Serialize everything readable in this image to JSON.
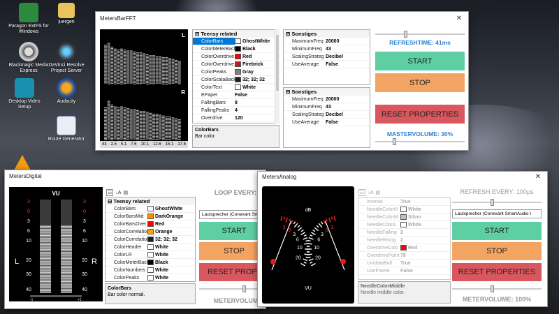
{
  "desktop": {
    "icons": [
      {
        "label": "Paragon ExtFS for Windows",
        "icon": "drive-icon"
      },
      {
        "label": "juergen",
        "icon": "folder-icon"
      },
      {
        "label": "Blackmagic Media Express",
        "icon": "film-reel-icon"
      },
      {
        "label": "DaVinci Resolve Project Server",
        "icon": "davinci-icon"
      },
      {
        "label": "Desktop Video Setup",
        "icon": "video-setup-icon"
      },
      {
        "label": "Audacity",
        "icon": "audacity-icon"
      },
      {
        "label": "Route Generator",
        "icon": "route-icon"
      }
    ]
  },
  "fft": {
    "title": "MetersBarFFT",
    "close": "✕",
    "channel_l": "L",
    "channel_r": "R",
    "freq_labels": [
      "43",
      "2.5",
      "5.1",
      "7.6",
      "10.1",
      "12.6",
      "15.1",
      "17.6"
    ],
    "bars_top": [
      0.82,
      0.86,
      0.78,
      0.74,
      0.72,
      0.74,
      0.72,
      0.7,
      0.7,
      0.68,
      0.66,
      0.66,
      0.64,
      0.62,
      0.6,
      0.6,
      0.58,
      0.58,
      0.56,
      0.56,
      0.54,
      0.52,
      0.5,
      0.48
    ],
    "bars_bottom": [
      0.7,
      0.84,
      0.76,
      0.72,
      0.7,
      0.72,
      0.7,
      0.68,
      0.66,
      0.66,
      0.64,
      0.62,
      0.62,
      0.6,
      0.58,
      0.56,
      0.56,
      0.54,
      0.52,
      0.5,
      0.5,
      0.48,
      0.46,
      0.44
    ],
    "props": {
      "category": "Teensy related",
      "rows": [
        {
          "k": "ColorBars",
          "v": "GhostWhite",
          "c": "#f8f8ff",
          "sel": true
        },
        {
          "k": "ColorMeterBack",
          "v": "Black",
          "c": "#000000"
        },
        {
          "k": "ColorOverdrive",
          "v": "Red",
          "c": "#ff0000"
        },
        {
          "k": "ColorOverdrive",
          "v": "Firebrick",
          "c": "#b22222"
        },
        {
          "k": "ColorPeaks",
          "v": "Gray",
          "c": "#808080"
        },
        {
          "k": "ColorScalaBack",
          "v": "32; 32; 32",
          "c": "#202020"
        },
        {
          "k": "ColorText",
          "v": "White",
          "c": "#ffffff"
        },
        {
          "k": "EPaper",
          "v": "False"
        },
        {
          "k": "FallingBars",
          "v": "8"
        },
        {
          "k": "FallingPeaks",
          "v": "4"
        },
        {
          "k": "Overdrive",
          "v": "120"
        }
      ]
    },
    "desc_title": "ColorBars",
    "desc_text": "Bar color.",
    "misc1": {
      "category": "Sonstiges",
      "rows": [
        {
          "k": "MaximumFreq",
          "v": "20000"
        },
        {
          "k": "MinimumFreq",
          "v": "43"
        },
        {
          "k": "ScalingStrateg",
          "v": "Decibel"
        },
        {
          "k": "UseAverage",
          "v": "False"
        }
      ]
    },
    "misc2": {
      "category": "Sonstiges",
      "rows": [
        {
          "k": "MaximumFreq",
          "v": "20000"
        },
        {
          "k": "MinimumFreq",
          "v": "43"
        },
        {
          "k": "ScalingStrateg",
          "v": "Decibel"
        },
        {
          "k": "UseAverage",
          "v": "False"
        }
      ]
    },
    "refresh_label": "REFRESHTIME: 41ms",
    "start": "START",
    "stop": "STOP",
    "reset": "RESET PROPERTIES",
    "volume_label": "MASTERVOLUME: 30%",
    "refresh_slider": 0.33,
    "volume_slider": 0.2
  },
  "digital": {
    "title": "MetersDigital",
    "vu": "VU",
    "l": "L",
    "r": "R",
    "scale": [
      "3",
      "0",
      "3",
      "6",
      "10",
      "20",
      "30",
      "40"
    ],
    "scale_left": [
      "3",
      "0",
      "3",
      "6",
      "10",
      "20",
      "30",
      "40"
    ],
    "bottom_labels": [
      "-1",
      "+1"
    ],
    "level_left": 0.72,
    "level_right": 0.72,
    "props": {
      "category": "Teensy related",
      "rows": [
        {
          "k": "ColorBars",
          "v": "GhostWhite",
          "c": "#f8f8ff"
        },
        {
          "k": "ColorBarsMid",
          "v": "DarkOrange",
          "c": "#ff8c00"
        },
        {
          "k": "ColorBarsOver",
          "v": "Red",
          "c": "#ff0000"
        },
        {
          "k": "ColorCorrelation",
          "v": "Orange",
          "c": "#ffa500"
        },
        {
          "k": "ColorCorrelation",
          "v": "32; 32; 32",
          "c": "#202020"
        },
        {
          "k": "ColorHeader",
          "v": "White",
          "c": "#ffffff"
        },
        {
          "k": "ColorLR",
          "v": "White",
          "c": "#ffffff"
        },
        {
          "k": "ColorMeterBack",
          "v": "Black",
          "c": "#000000"
        },
        {
          "k": "ColorNumbers",
          "v": "White",
          "c": "#ffffff"
        },
        {
          "k": "ColorPeaks",
          "v": "White",
          "c": "#ffffff"
        }
      ]
    },
    "desc_title": "ColorBars",
    "desc_text": "Bar color normal.",
    "loop_label": "LOOP EVERY:",
    "device": "Lautsprecher (Conexant SmartAu",
    "start": "START",
    "stop": "STOP",
    "reset": "RESET PROPE",
    "volume_label": "METERVOLUME:"
  },
  "analog": {
    "title": "MetersAnalog",
    "close": "✕",
    "db": "dB",
    "vu": "VU",
    "scale_left": [
      "3",
      "0",
      "3",
      "6",
      "10",
      "20"
    ],
    "scale_right": [
      "3",
      "0",
      "3",
      "6",
      "10",
      "20"
    ],
    "props": {
      "rows": [
        {
          "k": "Inverse",
          "v": "True"
        },
        {
          "k": "NeedleColorH",
          "v": "White",
          "c": "#ffffff"
        },
        {
          "k": "NeedleColorM",
          "v": "Silver",
          "c": "#c0c0c0"
        },
        {
          "k": "NeedleColorL",
          "v": "White",
          "c": "#ffffff"
        },
        {
          "k": "NeedleFalling",
          "v": "2"
        },
        {
          "k": "NeedleRising",
          "v": "2"
        },
        {
          "k": "OverdriveColo",
          "v": "Red",
          "c": "#ff0000"
        },
        {
          "k": "OverdrivePoint",
          "v": "78"
        },
        {
          "k": "UnidataBall",
          "v": "True"
        },
        {
          "k": "UseFrame",
          "v": "False"
        }
      ]
    },
    "desc_title": "NeedleColorMiddle",
    "desc_text": "Needle middle color.",
    "refresh_label": "REFRESH EVERY: 100µs",
    "device": "Lautsprecher (Conexant SmartAudio I",
    "start": "START",
    "stop": "STOP",
    "reset": "RESET PROPERTIES",
    "volume_label": "METERVOLUME: 100%",
    "refresh_slider": 0.45,
    "volume_slider": 0.45
  },
  "colors": {
    "start": "#5ecfa3",
    "stop": "#f4a462",
    "reset": "#d9575e",
    "accent": "#2c7fd0"
  }
}
